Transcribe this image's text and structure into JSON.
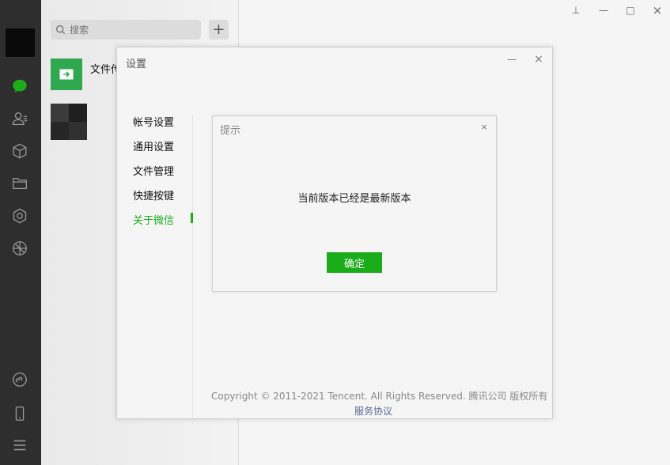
{
  "sidebar": {
    "icons": [
      "chat-icon",
      "contacts-icon",
      "favorites-cube-icon",
      "folder-icon",
      "moments-icon",
      "channels-icon",
      "mini-program-icon",
      "phone-icon",
      "menu-icon"
    ],
    "accent": "#1aad19"
  },
  "chatlist": {
    "search_placeholder": "搜索",
    "add_label": "+",
    "file_transfer_name": "文件传"
  },
  "settings": {
    "title": "设置",
    "nav": [
      "帐号设置",
      "通用设置",
      "文件管理",
      "快捷按键",
      "关于微信"
    ],
    "active_index": 4,
    "copyright": "Copyright © 2011-2021 Tencent. All Rights Reserved. 腾讯公司 版权所有",
    "service_link": "服务协议"
  },
  "prompt": {
    "title": "提示",
    "message": "当前版本已经是最新版本",
    "confirm_label": "确定",
    "close_label": "×"
  },
  "window_controls": {
    "pin": "⊥",
    "minimize": "—",
    "maximize": "□",
    "close": "×"
  },
  "colors": {
    "sidebar_bg": "#2e2e2e",
    "accent_green": "#1aad19",
    "link_blue": "#576b95"
  }
}
